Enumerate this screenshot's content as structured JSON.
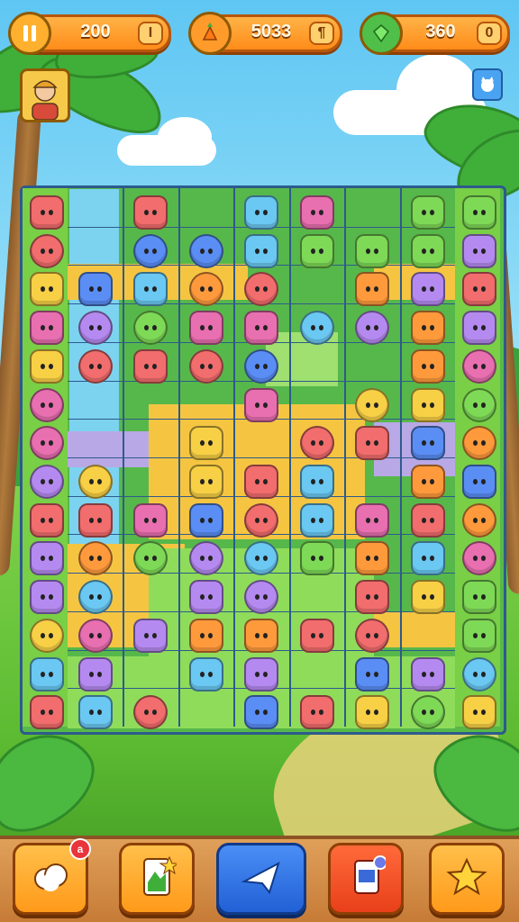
{
  "hud": {
    "pause_icon": "pause-icon",
    "currency_1": {
      "icon": "coin-icon",
      "value": "200",
      "add_label": "I"
    },
    "currency_2": {
      "icon": "carrot-icon",
      "value": "5033",
      "add_label": "¶"
    },
    "currency_3": {
      "icon": "gem-icon",
      "value": "360",
      "add_label": "0"
    }
  },
  "player": {
    "avatar_icon": "player-avatar-icon"
  },
  "side_button": {
    "icon": "cat-icon"
  },
  "colors": {
    "accent_orange": "#ff8c1a",
    "board_border": "#2e5a8c",
    "grass": "#79cf46",
    "sand": "#f5c542",
    "lavender": "#b9a8e6",
    "water": "#7cd3f0"
  },
  "bottom_bar": {
    "buttons": [
      {
        "icon": "cloud-icon",
        "badge": "a"
      },
      {
        "icon": "card-icon",
        "badge": ""
      },
      {
        "icon": "star-arrow-icon",
        "badge": ""
      },
      {
        "icon": "tablet-icon",
        "badge": ""
      },
      {
        "icon": "star-icon",
        "badge": ""
      }
    ]
  }
}
